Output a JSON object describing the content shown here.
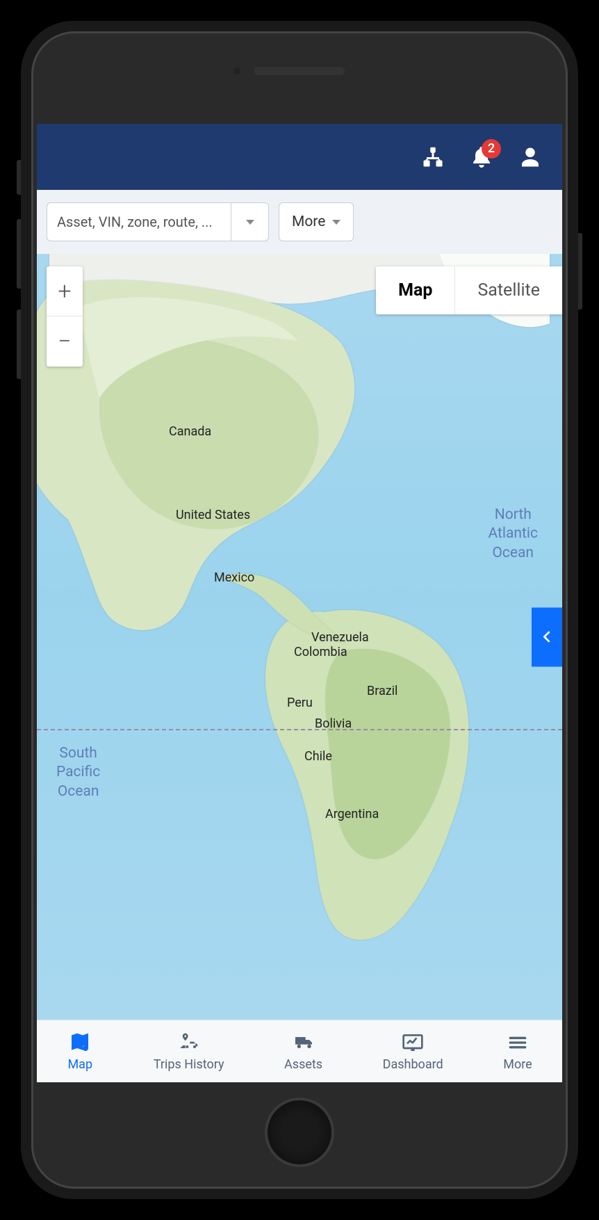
{
  "header": {
    "notification_count": "2"
  },
  "filter": {
    "search_placeholder": "Asset, VIN, zone, route, ...",
    "more_label": "More"
  },
  "map": {
    "zoom_in": "+",
    "zoom_out": "−",
    "type_map": "Map",
    "type_satellite": "Satellite",
    "labels": {
      "canada": "Canada",
      "united_states": "United States",
      "mexico": "Mexico",
      "venezuela": "Venezuela",
      "colombia": "Colombia",
      "peru": "Peru",
      "brazil": "Brazil",
      "bolivia": "Bolivia",
      "chile": "Chile",
      "argentina": "Argentina",
      "north_atlantic": "North\nAtlantic\nOcean",
      "south_pacific": "South\nPacific\nOcean"
    }
  },
  "nav": {
    "map": "Map",
    "trips": "Trips History",
    "assets": "Assets",
    "dashboard": "Dashboard",
    "more": "More"
  },
  "colors": {
    "header_bg": "#1f3a6e",
    "accent": "#0d6efd",
    "badge": "#e53935",
    "panel_bg": "#eef2f6",
    "muted": "#546478"
  }
}
